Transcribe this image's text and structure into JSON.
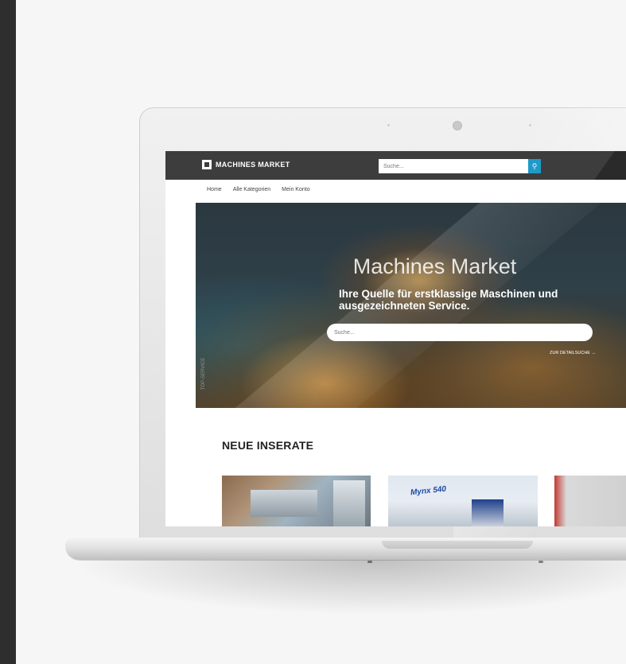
{
  "site": {
    "brand": "MACHINES MARKET",
    "search_placeholder": "Suche...",
    "nav": [
      "Home",
      "Alle Kategorien",
      "Mein Konto"
    ]
  },
  "hero": {
    "title": "Machines Market",
    "subtitle": "Ihre Quelle für erstklassige Maschinen und ausgezeichneten Service.",
    "search_placeholder": "Suche...",
    "detail_link": "ZUR DETAILSUCHE →",
    "side_text": "TOP-SERVICE"
  },
  "section": {
    "title": "NEUE INSERATE"
  },
  "listings": [
    {
      "image_text": ""
    },
    {
      "image_text": "Mynx 540"
    },
    {
      "image_text": ""
    }
  ],
  "colors": {
    "header_bg": "#3d3d3d",
    "accent": "#1f9ac9",
    "page_bg": "#f6f6f6",
    "left_strip": "#2e2e2e"
  }
}
